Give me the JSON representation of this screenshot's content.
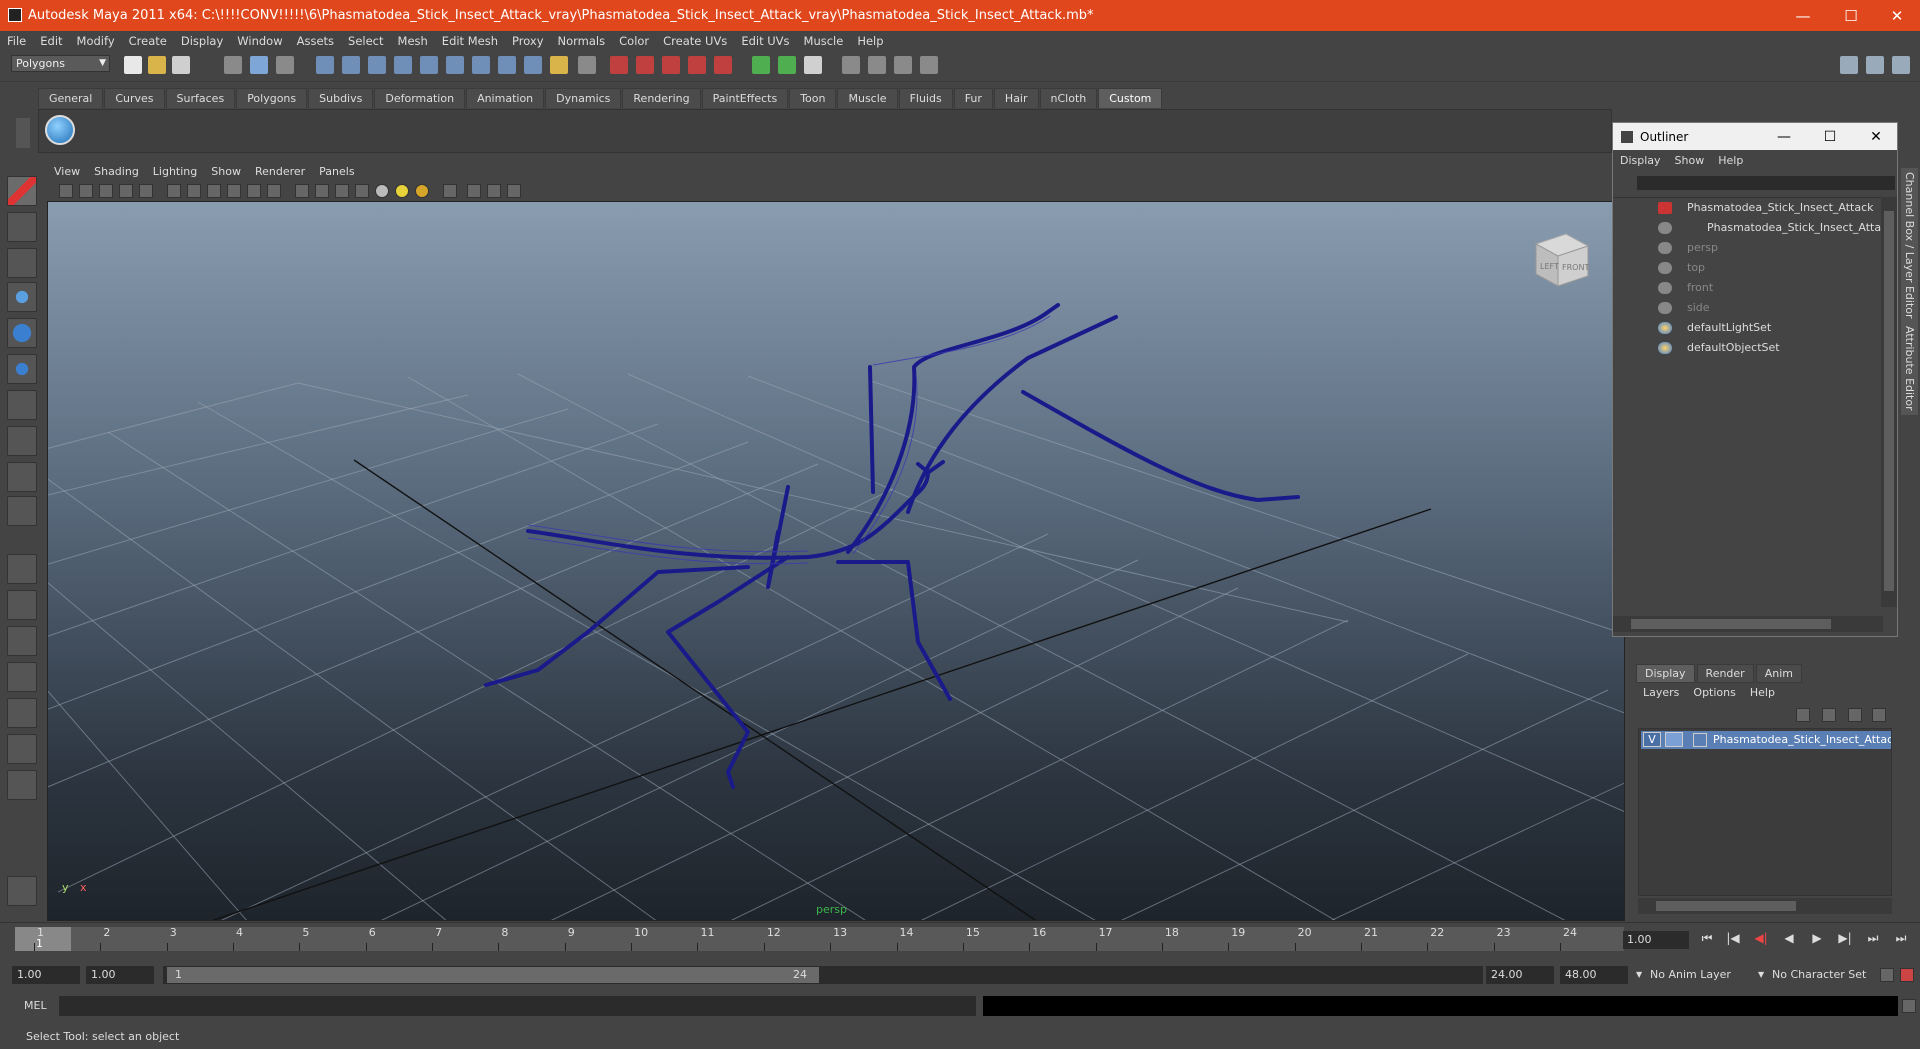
{
  "window": {
    "title": "Autodesk Maya 2011 x64: C:\\!!!!CONV!!!!!\\6\\Phasmatodea_Stick_Insect_Attack_vray\\Phasmatodea_Stick_Insect_Attack_vray\\Phasmatodea_Stick_Insect_Attack.mb*",
    "minimize": "—",
    "maximize": "☐",
    "close": "✕"
  },
  "menubar": [
    "File",
    "Edit",
    "Modify",
    "Create",
    "Display",
    "Window",
    "Assets",
    "Select",
    "Mesh",
    "Edit Mesh",
    "Proxy",
    "Normals",
    "Color",
    "Create UVs",
    "Edit UVs",
    "Muscle",
    "Help"
  ],
  "statusline": {
    "mode": "Polygons"
  },
  "shelf": {
    "tabs": [
      "General",
      "Curves",
      "Surfaces",
      "Polygons",
      "Subdivs",
      "Deformation",
      "Animation",
      "Dynamics",
      "Rendering",
      "PaintEffects",
      "Toon",
      "Muscle",
      "Fluids",
      "Fur",
      "Hair",
      "nCloth",
      "Custom"
    ],
    "active_tab": "Custom"
  },
  "panel": {
    "menu": [
      "View",
      "Shading",
      "Lighting",
      "Show",
      "Renderer",
      "Panels"
    ],
    "camera_label": "persp",
    "axis_y": "y",
    "axis_x": "x",
    "viewcube_left": "LEFT",
    "viewcube_front": "FRONT"
  },
  "outliner": {
    "title": "Outliner",
    "menu": [
      "Display",
      "Show",
      "Help"
    ],
    "items": [
      {
        "label": "Phasmatodea_Stick_Insect_Attack",
        "dim": false,
        "indent": 0
      },
      {
        "label": "Phasmatodea_Stick_Insect_Attack_",
        "dim": false,
        "indent": 1
      },
      {
        "label": "persp",
        "dim": true,
        "indent": 0
      },
      {
        "label": "top",
        "dim": true,
        "indent": 0
      },
      {
        "label": "front",
        "dim": true,
        "indent": 0
      },
      {
        "label": "side",
        "dim": true,
        "indent": 0
      },
      {
        "label": "defaultLightSet",
        "dim": false,
        "indent": 0
      },
      {
        "label": "defaultObjectSet",
        "dim": false,
        "indent": 0
      }
    ]
  },
  "side_tabs": {
    "channel_box": "Channel Box / Layer Editor",
    "attribute_editor": "Attribute Editor"
  },
  "layer_editor": {
    "tabs": [
      "Display",
      "Render",
      "Anim"
    ],
    "active_tab": "Display",
    "menu": [
      "Layers",
      "Options",
      "Help"
    ],
    "layer": {
      "visible": "V",
      "name": "Phasmatodea_Stick_Insect_Attack_la"
    }
  },
  "timeline": {
    "ticks": [
      "1",
      "2",
      "3",
      "4",
      "5",
      "6",
      "7",
      "8",
      "9",
      "10",
      "11",
      "12",
      "13",
      "14",
      "15",
      "16",
      "17",
      "18",
      "19",
      "20",
      "21",
      "22",
      "23",
      "24"
    ],
    "current_frame": "1",
    "current_field": "1.00",
    "playback": [
      "⏮",
      "|◀",
      "◀|",
      "◀",
      "▶",
      "▶|",
      "⏭",
      "⏭"
    ]
  },
  "range": {
    "start": "1.00",
    "playback_start": "1.00",
    "slider_start": "1",
    "slider_end": "24",
    "playback_end": "24.00",
    "end": "48.00",
    "anim_layer": "No Anim Layer",
    "character_set": "No Character Set"
  },
  "command": {
    "label": "MEL"
  },
  "help": {
    "text": "Select Tool: select an object"
  },
  "colors": {
    "title_bar": "#e0471c",
    "wireframe": "#1a1a8a",
    "selection": "#5a7fb5"
  }
}
